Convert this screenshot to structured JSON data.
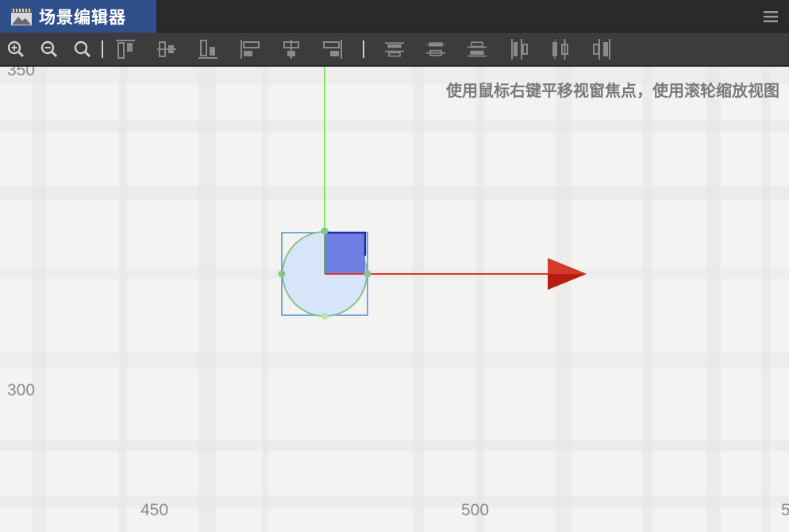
{
  "panel": {
    "tab_label": "场景编辑器",
    "tab_icon": "scene-editor-icon",
    "menu_icon": "hamburger-menu-icon"
  },
  "toolbar": {
    "buttons": [
      {
        "icon": "zoom-in-icon"
      },
      {
        "icon": "zoom-out-icon"
      },
      {
        "icon": "zoom-reset-icon"
      },
      {
        "icon": "align-top-icon"
      },
      {
        "icon": "align-vertical-center-icon"
      },
      {
        "icon": "align-bottom-icon"
      },
      {
        "icon": "align-left-icon"
      },
      {
        "icon": "align-horizontal-center-icon"
      },
      {
        "icon": "align-right-icon"
      },
      {
        "icon": "distribute-top-icon"
      },
      {
        "icon": "distribute-vertical-center-icon"
      },
      {
        "icon": "distribute-bottom-icon"
      },
      {
        "icon": "distribute-left-icon"
      },
      {
        "icon": "distribute-horizontal-center-icon"
      },
      {
        "icon": "distribute-right-icon"
      }
    ]
  },
  "viewport": {
    "hint": "使用鼠标右键平移视窗焦点，使用滚轮缩放视图",
    "ruler": {
      "y_labels": [
        "350",
        "300"
      ],
      "x_labels": [
        "450",
        "500",
        "5"
      ]
    },
    "colors": {
      "y_axis_handle": "#7de85a",
      "x_axis_handle": "#d83a2a",
      "arrow_head": "#b81c10",
      "selection_rect": "#4a90d9",
      "circle_fill": "#d6e5fa",
      "circle_stroke": "#8cc28c",
      "rotate_square": "#6f7fe3"
    }
  }
}
